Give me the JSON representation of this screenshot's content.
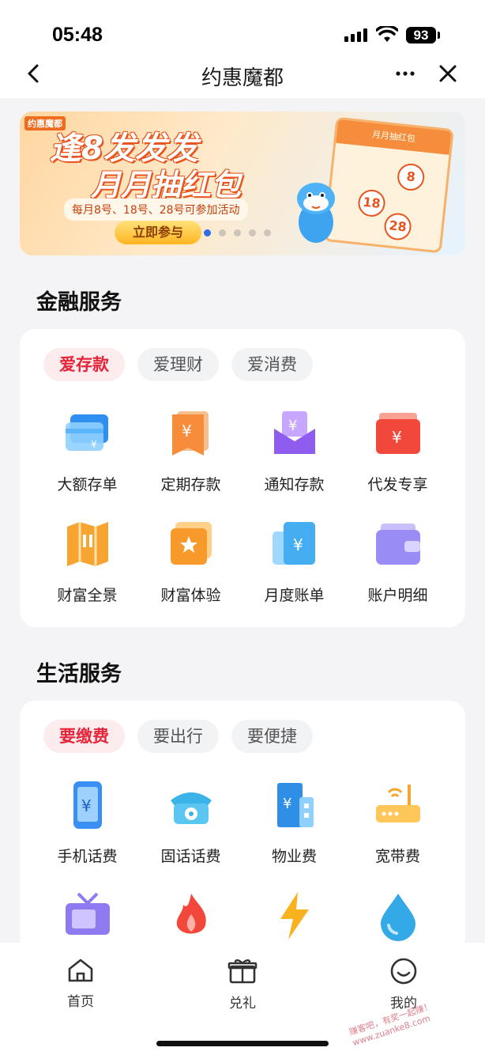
{
  "status_bar": {
    "time": "05:48",
    "battery": "93"
  },
  "nav": {
    "title": "约惠魔都",
    "back_icon": "chevron-left",
    "more_icon": "ellipsis",
    "close_icon": "close"
  },
  "banner": {
    "brand": "约惠魔都",
    "title_line1": "逢8发发发",
    "title_line2": "月月抽红包",
    "subtitle": "每月8号、18号、28号可参加活动",
    "cta": "立即参与",
    "calendar_header": "月月抽红包",
    "calendar_numbers": [
      "8",
      "18",
      "28"
    ],
    "page_count": 5,
    "active_page": 1
  },
  "finance": {
    "title": "金融服务",
    "tabs": [
      "爱存款",
      "爱理财",
      "爱消费"
    ],
    "active_tab": 0,
    "items": [
      {
        "label": "大额存单",
        "icon": "card-icon",
        "color": "#3aa3f5"
      },
      {
        "label": "定期存款",
        "icon": "yuan-bookmark-icon",
        "color": "#f89a4a"
      },
      {
        "label": "通知存款",
        "icon": "yuan-envelope-icon",
        "color": "#9b6af2"
      },
      {
        "label": "代发专享",
        "icon": "yuan-wallet-icon",
        "color": "#f3533e"
      },
      {
        "label": "财富全景",
        "icon": "map-icon",
        "color": "#f7a530"
      },
      {
        "label": "财富体验",
        "icon": "star-badge-icon",
        "color": "#f79a2b"
      },
      {
        "label": "月度账单",
        "icon": "yuan-bill-icon",
        "color": "#4bb4f0"
      },
      {
        "label": "账户明细",
        "icon": "wallet-icon",
        "color": "#9a8cf5"
      }
    ]
  },
  "life": {
    "title": "生活服务",
    "tabs": [
      "要缴费",
      "要出行",
      "要便捷"
    ],
    "active_tab": 0,
    "items": [
      {
        "label": "手机话费",
        "icon": "phone-yuan-icon",
        "color": "#3a8ff5"
      },
      {
        "label": "固话话费",
        "icon": "telephone-icon",
        "color": "#3bb3e8"
      },
      {
        "label": "物业费",
        "icon": "building-yuan-icon",
        "color": "#2f8fe6"
      },
      {
        "label": "宽带费",
        "icon": "router-icon",
        "color": "#f7a530"
      },
      {
        "label": "",
        "icon": "tv-icon",
        "color": "#8f7af2"
      },
      {
        "label": "",
        "icon": "flame-icon",
        "color": "#f2483c"
      },
      {
        "label": "",
        "icon": "lightning-icon",
        "color": "#f7b21e"
      },
      {
        "label": "",
        "icon": "water-drop-icon",
        "color": "#33a9e8"
      }
    ]
  },
  "tabbar": {
    "items": [
      {
        "label": "首页",
        "icon": "home-icon"
      },
      {
        "label": "兑礼",
        "icon": "gift-icon"
      },
      {
        "label": "我的",
        "icon": "smile-icon"
      }
    ]
  },
  "watermark": "赚客吧，有奖一起赚！ www.zuanke8.com"
}
